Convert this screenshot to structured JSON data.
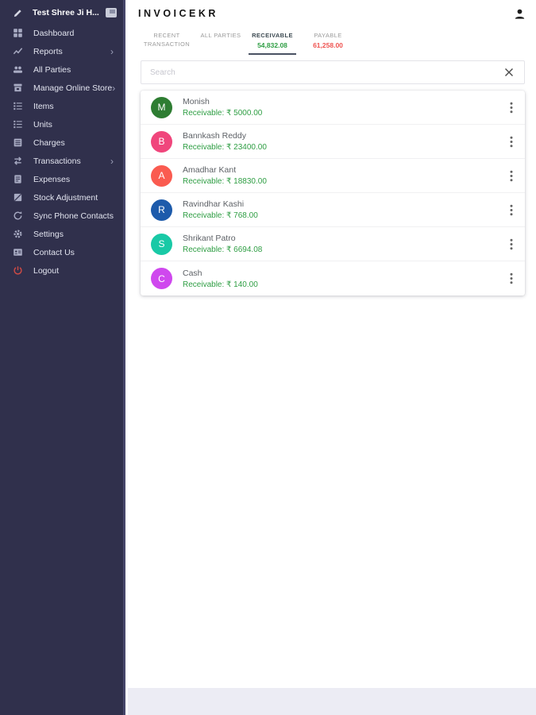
{
  "sidebar": {
    "business_name": "Test Shree Ji H...",
    "items": [
      {
        "label": "Dashboard"
      },
      {
        "label": "Reports",
        "chevron": "›"
      },
      {
        "label": "All Parties"
      },
      {
        "label": "Manage Online Store",
        "chevron": "›"
      },
      {
        "label": "Items"
      },
      {
        "label": "Units"
      },
      {
        "label": "Charges"
      },
      {
        "label": "Transactions",
        "chevron": "›"
      },
      {
        "label": "Expenses"
      },
      {
        "label": "Stock Adjustment"
      },
      {
        "label": "Sync Phone Contacts"
      },
      {
        "label": "Settings"
      },
      {
        "label": "Contact Us"
      },
      {
        "label": "Logout"
      }
    ]
  },
  "header": {
    "title": "INVOICEKR"
  },
  "tabs": [
    {
      "label": "RECENT TRANSACTION"
    },
    {
      "label": "ALL PARTIES"
    },
    {
      "label": "RECEIVABLE",
      "amount": "54,832.08"
    },
    {
      "label": "PAYABLE",
      "amount": "61,258.00"
    }
  ],
  "search": {
    "placeholder": "Search"
  },
  "parties": [
    {
      "initial": "M",
      "name": "Monish",
      "receivable": "Receivable: ₹ 5000.00",
      "avatar_color": "#2e7d32"
    },
    {
      "initial": "B",
      "name": "Bannkash Reddy",
      "receivable": "Receivable: ₹ 23400.00",
      "avatar_color": "#f0467c"
    },
    {
      "initial": "A",
      "name": "Amadhar Kant",
      "receivable": "Receivable: ₹ 18830.00",
      "avatar_color": "#fa5b50"
    },
    {
      "initial": "R",
      "name": "Ravindhar Kashi",
      "receivable": "Receivable: ₹ 768.00",
      "avatar_color": "#1d5bab"
    },
    {
      "initial": "S",
      "name": "Shrikant Patro",
      "receivable": "Receivable: ₹ 6694.08",
      "avatar_color": "#19c9a6"
    },
    {
      "initial": "C",
      "name": "Cash",
      "receivable": "Receivable: ₹ 140.00",
      "avatar_color": "#cf48ee"
    }
  ],
  "colors": {
    "sidebar_bg": "#30304c",
    "receivable_green": "#2f9e44",
    "payable_red": "#ef5350",
    "active_tab_underline": "#4a5263",
    "logout_red": "#cd4a45"
  }
}
